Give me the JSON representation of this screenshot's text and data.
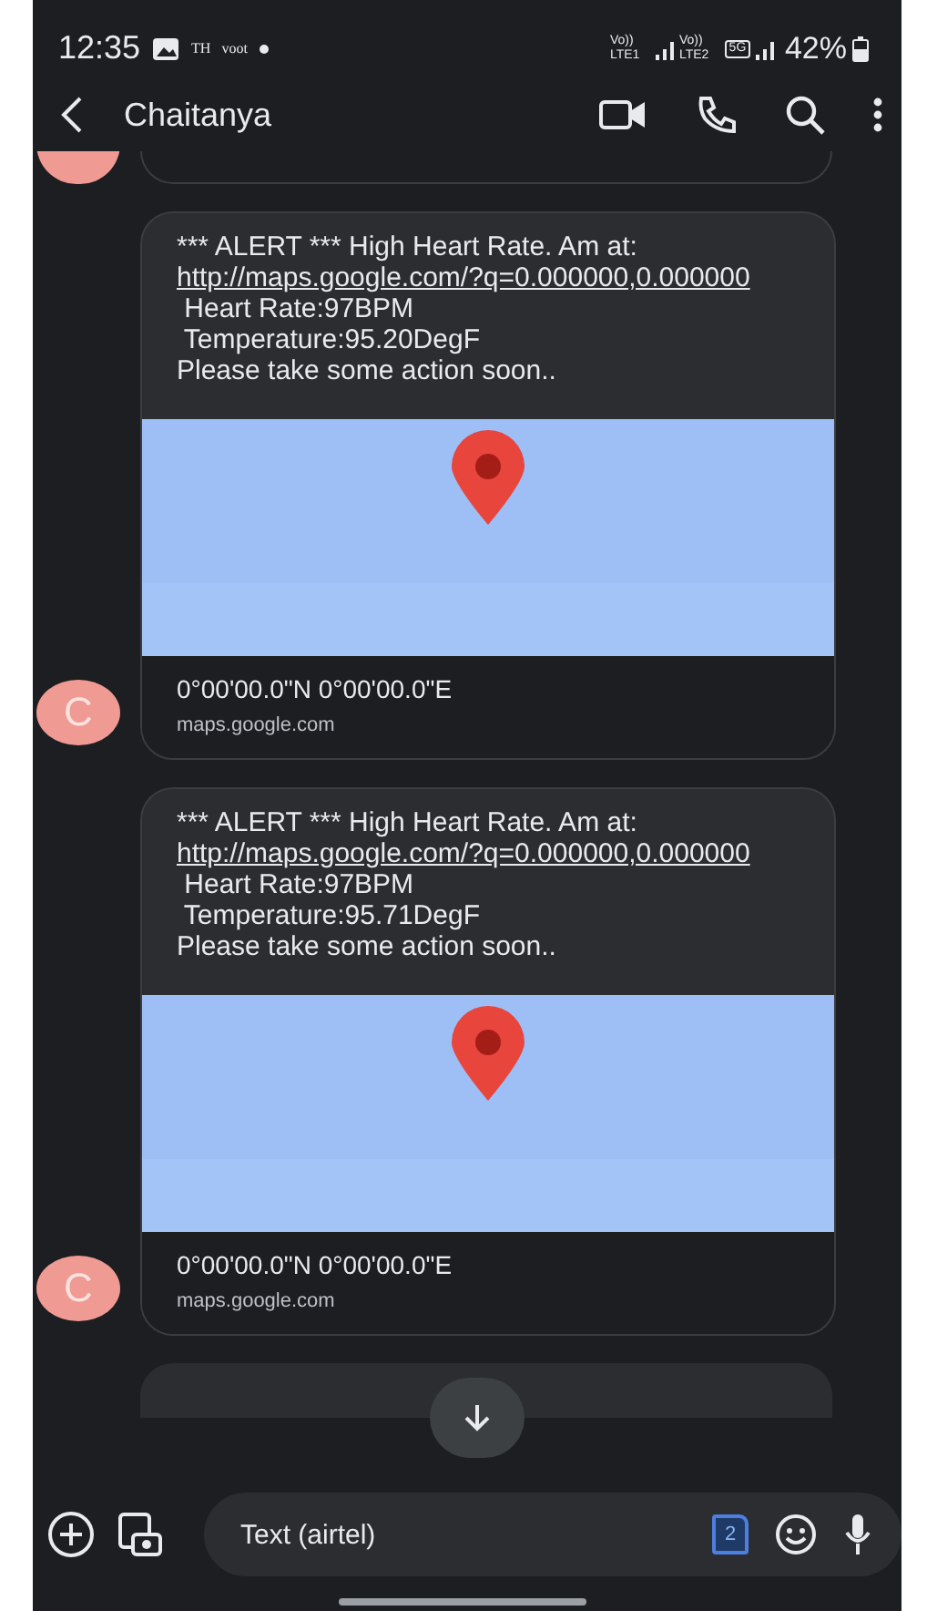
{
  "status_bar": {
    "time": "12:35",
    "notifications": [
      "TH",
      "voot"
    ],
    "sims": [
      "Vo)) LTE1",
      "Vo)) LTE2"
    ],
    "network": "5G",
    "battery": "42%"
  },
  "header": {
    "contact": "Chaitanya"
  },
  "messages": [
    {
      "avatar": "C",
      "intro": "*** ALERT *** High Heart Rate. Am at:",
      "link": "http://maps.google.com/?q=0.000000,0.000000",
      "lines": [
        " Heart Rate:97BPM",
        " Temperature:95.20DegF",
        "Please take some action soon.."
      ],
      "location": "0°00'00.0\"N 0°00'00.0\"E",
      "domain": "maps.google.com"
    },
    {
      "avatar": "C",
      "intro": "*** ALERT *** High Heart Rate. Am at:",
      "link": "http://maps.google.com/?q=0.000000,0.000000",
      "lines": [
        " Heart Rate:97BPM",
        " Temperature:95.71DegF",
        "Please take some action soon.."
      ],
      "location": "0°00'00.0\"N 0°00'00.0\"E",
      "domain": "maps.google.com"
    }
  ],
  "compose": {
    "placeholder": "Text (airtel)",
    "sim": "2"
  }
}
